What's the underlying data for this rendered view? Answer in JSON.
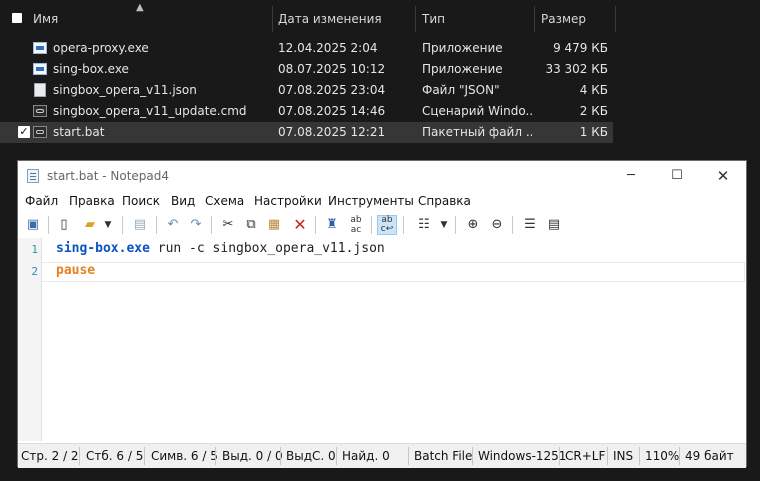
{
  "explorer": {
    "columns": {
      "name": "Имя",
      "date": "Дата изменения",
      "type": "Тип",
      "size": "Размер"
    },
    "files": [
      {
        "name": "opera-proxy.exe",
        "date": "12.04.2025 2:04",
        "type": "Приложение",
        "size": "9 479 КБ",
        "icon": "exe-icon"
      },
      {
        "name": "sing-box.exe",
        "date": "08.07.2025 10:12",
        "type": "Приложение",
        "size": "33 302 КБ",
        "icon": "exe-icon"
      },
      {
        "name": "singbox_opera_v11.json",
        "date": "07.08.2025 23:04",
        "type": "Файл \"JSON\"",
        "size": "4 КБ",
        "icon": "json-file-icon"
      },
      {
        "name": "singbox_opera_v11_update.cmd",
        "date": "07.08.2025 14:46",
        "type": "Сценарий Windo...",
        "size": "2 КБ",
        "icon": "cmd-file-icon"
      },
      {
        "name": "start.bat",
        "date": "07.08.2025 12:21",
        "type": "Пакетный файл ...",
        "size": "1 КБ",
        "icon": "bat-file-icon",
        "selected": true
      }
    ]
  },
  "notepad": {
    "title": "start.bat - Notepad4",
    "menu": [
      "Файл",
      "Правка",
      "Поиск",
      "Вид",
      "Схема",
      "Настройки",
      "Инструменты",
      "Справка"
    ],
    "lines": [
      {
        "num": "1",
        "cmd": "sing-box.exe",
        "rest": " run -c singbox_opera_v11.json"
      },
      {
        "num": "2",
        "cmd": "pause",
        "rest": ""
      }
    ],
    "status": {
      "line": "Стр. 2 / 2",
      "col": "Стб. 6 / 5",
      "char": "Симв. 6 / 5",
      "sel": "Выд. 0 / 0",
      "selb": "ВыдС. 0",
      "found": "Найд. 0",
      "scheme": "Batch File",
      "encoding": "Windows-1251",
      "eol": "CR+LF",
      "mode": "INS",
      "zoom": "110%",
      "size": "49 байт"
    }
  }
}
